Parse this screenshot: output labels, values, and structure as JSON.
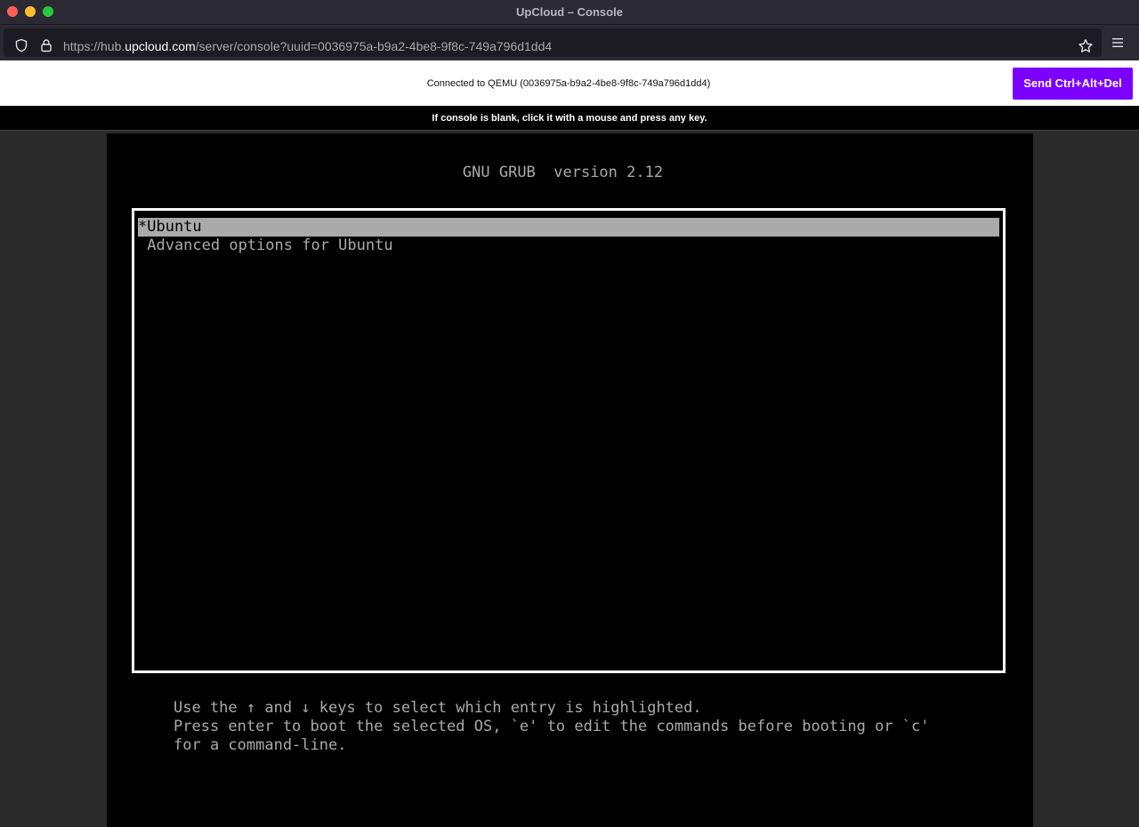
{
  "window": {
    "title": "UpCloud – Console"
  },
  "browser": {
    "url_prefix": "https://hub.",
    "url_host": "upcloud.com",
    "url_path": "/server/console?uuid=0036975a-b9a2-4be8-9f8c-749a796d1dd4",
    "icons": [
      "shield-icon",
      "lock-icon",
      "star-icon",
      "menu-icon"
    ]
  },
  "page": {
    "status_text": "Connected to QEMU (0036975a-b9a2-4be8-9f8c-749a796d1dd4)",
    "send_button_label": "Send Ctrl+Alt+Del",
    "hint_text": "If console is blank, click it with a mouse and press any key."
  },
  "console": {
    "title": "GNU GRUB  version 2.12",
    "entries": [
      {
        "label": "*Ubuntu",
        "selected": true
      },
      {
        "label": " Advanced options for Ubuntu",
        "selected": false
      }
    ],
    "help_lines": [
      "Use the ↑ and ↓ keys to select which entry is highlighted.",
      "Press enter to boot the selected OS, `e' to edit the commands before booting or `c'",
      "for a command-line."
    ]
  },
  "colors": {
    "accent": "#7b00ff",
    "console_text": "#aaaaaa",
    "console_bg": "#000000"
  }
}
